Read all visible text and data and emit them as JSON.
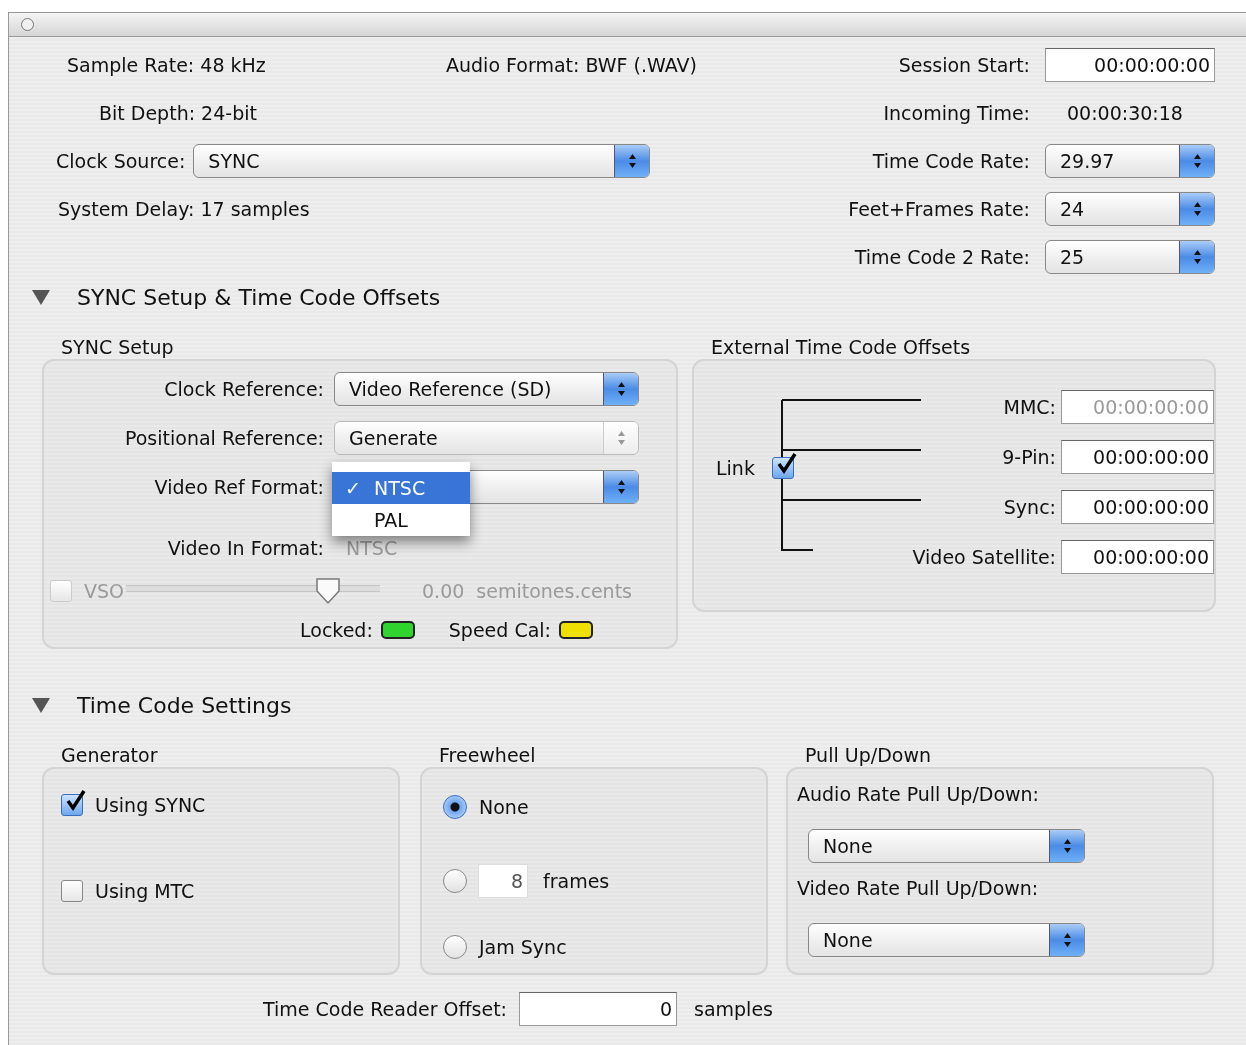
{
  "window": {
    "close_enabled": false
  },
  "top": {
    "sample_rate": "Sample Rate: 48 kHz",
    "audio_format": "Audio Format: BWF (.WAV)",
    "bit_depth": "Bit Depth: 24-bit",
    "clock_source": {
      "label": "Clock Source:",
      "value": "SYNC"
    },
    "system_delay": "System Delay: 17 samples",
    "session_start": {
      "label": "Session Start:",
      "value": "00:00:00:00"
    },
    "incoming_time": {
      "label": "Incoming Time:",
      "value": "00:00:30:18"
    },
    "rates": [
      {
        "label": "Time Code Rate:",
        "value": "29.97"
      },
      {
        "label": "Feet+Frames Rate:",
        "value": "24"
      },
      {
        "label": "Time Code 2 Rate:",
        "value": "25"
      }
    ]
  },
  "sync_section": {
    "title": "SYNC Setup & Time Code Offsets",
    "expanded": true
  },
  "sync_setup": {
    "title": "SYNC Setup",
    "rows": [
      {
        "label": "Clock Reference:",
        "value": "Video Reference (SD)",
        "disabled": false
      },
      {
        "label": "Positional Reference:",
        "value": "Generate",
        "disabled": true
      },
      {
        "label": "Video Ref Format:",
        "disabled": false
      }
    ],
    "menu": {
      "check": "✓",
      "items": [
        {
          "label": "NTSC",
          "selected": true
        },
        {
          "label": "PAL",
          "selected": false
        }
      ]
    },
    "video_in": {
      "label": "Video In Format:",
      "value": "NTSC"
    },
    "vso": {
      "label": "VSO",
      "checked": false,
      "disabled": true,
      "level": 0.83,
      "reading": "0.00",
      "unit": "semitones.cents"
    },
    "indicators": [
      {
        "label": "Locked:",
        "color": "#2fd42f"
      },
      {
        "label": "Speed Cal:",
        "color": "#f0e000"
      }
    ]
  },
  "external_offsets": {
    "title": "External Time Code Offsets",
    "link": {
      "label": "Link",
      "checked": true
    },
    "rows": [
      {
        "label": "MMC:",
        "value": "00:00:00:00",
        "disabled": true
      },
      {
        "label": "9-Pin:",
        "value": "00:00:00:00",
        "disabled": false
      },
      {
        "label": "Sync:",
        "value": "00:00:00:00",
        "disabled": false
      },
      {
        "label": "Video Satellite:",
        "value": "00:00:00:00",
        "disabled": false
      }
    ]
  },
  "time_code_section": {
    "title": "Time Code Settings",
    "expanded": true
  },
  "generator": {
    "title": "Generator",
    "options": [
      {
        "label": "Using SYNC",
        "checked": true
      },
      {
        "label": "Using MTC",
        "checked": false
      }
    ]
  },
  "freewheel": {
    "title": "Freewheel",
    "options": [
      {
        "kind": "plain",
        "label": "None",
        "selected": true
      },
      {
        "kind": "frames",
        "value": "8",
        "label": "frames",
        "selected": false
      },
      {
        "kind": "plain",
        "label": "Jam Sync",
        "selected": false
      }
    ]
  },
  "pull": {
    "title": "Pull Up/Down",
    "selects": [
      {
        "label": "Audio Rate Pull Up/Down:",
        "value": "None"
      },
      {
        "label": "Video Rate Pull Up/Down:",
        "value": "None"
      }
    ]
  },
  "reader_offset": {
    "label": "Time Code Reader Offset:",
    "value": "0",
    "unit": "samples"
  }
}
